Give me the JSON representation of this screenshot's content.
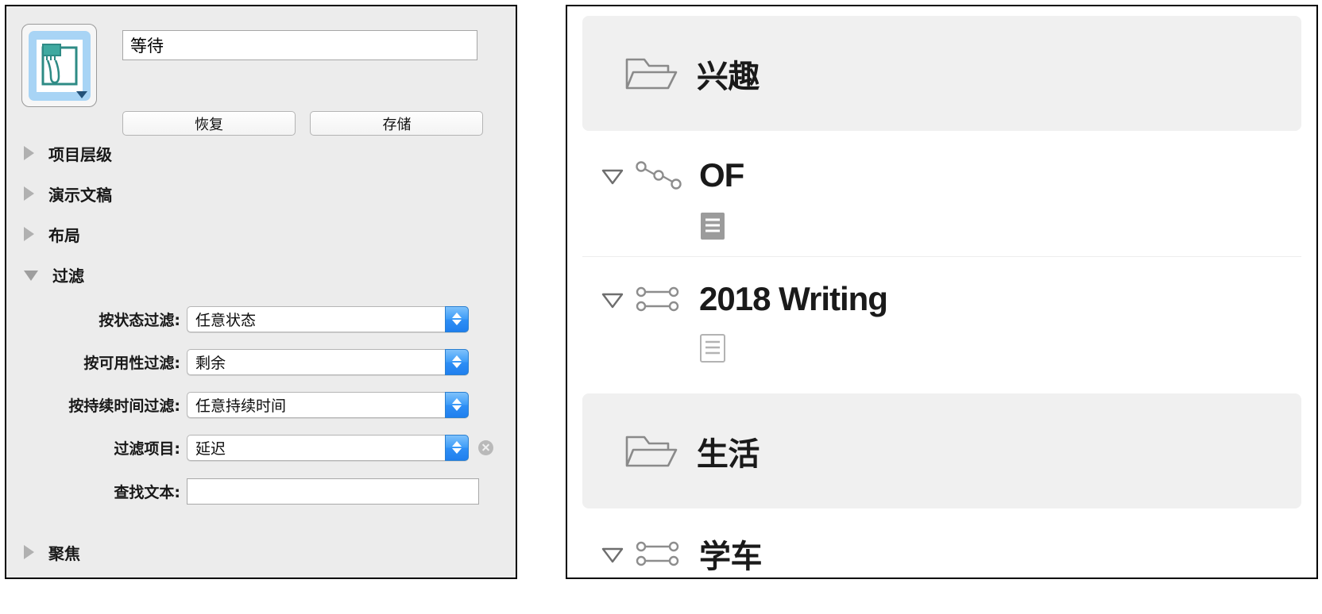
{
  "inspector": {
    "perspective_icon": "perspective-icon",
    "name_field_value": "等待",
    "name_field_placeholder": "",
    "revert_label": "恢复",
    "save_label": "存储",
    "sections": [
      {
        "label": "项目层级",
        "expanded": false
      },
      {
        "label": "演示文稿",
        "expanded": false
      },
      {
        "label": "布局",
        "expanded": false
      },
      {
        "label": "过滤",
        "expanded": true
      },
      {
        "label": "聚焦",
        "expanded": false
      }
    ],
    "filter": {
      "rows": [
        {
          "label": "按状态过滤:",
          "value": "任意状态",
          "type": "popup",
          "removable": false
        },
        {
          "label": "按可用性过滤:",
          "value": "剩余",
          "type": "popup",
          "removable": false
        },
        {
          "label": "按持续时间过滤:",
          "value": "任意持续时间",
          "type": "popup",
          "removable": false
        },
        {
          "label": "过滤项目:",
          "value": "延迟",
          "type": "popup",
          "removable": true
        },
        {
          "label": "查找文本:",
          "value": "",
          "type": "text",
          "removable": false
        }
      ]
    }
  },
  "outline": {
    "rows": [
      {
        "title": "兴趣",
        "kind": "folder",
        "icon": "folder-icon",
        "twisty": false,
        "note": false,
        "note_style": ""
      },
      {
        "title": "OF",
        "kind": "project",
        "icon": "sequential-project-icon",
        "twisty": true,
        "note": true,
        "note_style": "filled"
      },
      {
        "title": "2018 Writing",
        "kind": "project",
        "icon": "parallel-project-icon",
        "twisty": true,
        "note": true,
        "note_style": "outline"
      },
      {
        "title": "生活",
        "kind": "folder",
        "icon": "folder-icon",
        "twisty": false,
        "note": false,
        "note_style": ""
      },
      {
        "title": "学车",
        "kind": "project",
        "icon": "parallel-project-icon",
        "twisty": true,
        "note": false,
        "note_style": ""
      }
    ]
  },
  "colors": {
    "panel_bg": "#ececec",
    "outline_bg": "#ffffff",
    "row_highlight": "#f0f0f0",
    "stepper_blue": "#2f8ff5",
    "icon_teal": "#2e8b85",
    "icon_blue": "#a8d4f5",
    "note_gray": "#9b9b9b"
  }
}
